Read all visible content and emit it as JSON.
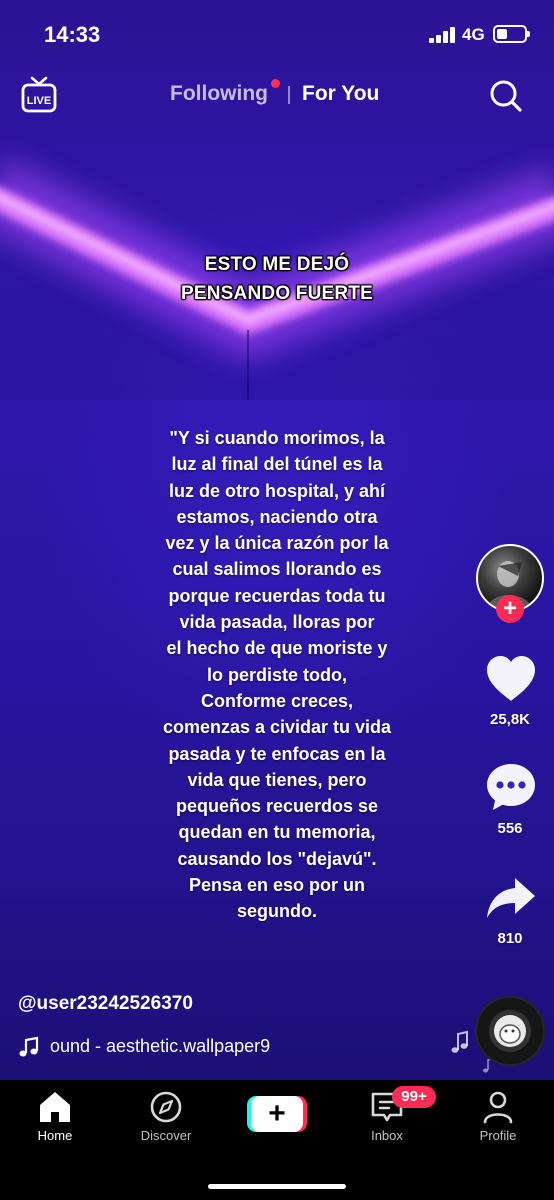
{
  "status_bar": {
    "time": "14:33",
    "network": "4G",
    "battery_level": 0.4
  },
  "top_nav": {
    "live_icon": "live-tv-icon",
    "tabs": [
      {
        "label": "Following",
        "active": false
      },
      {
        "label": "For You",
        "active": true
      }
    ],
    "search_icon": "search-icon"
  },
  "video": {
    "headline": [
      "ESTO ME DEJÓ",
      "PENSANDO FUERTE"
    ],
    "quote": "\"Y si cuando morimos, la\nluz al final del túnel es la\nluz de otro hospital, y ahí\nestamos, naciendo otra\nvez y la única razón por la\ncual salimos llorando es\nporque recuerdas toda tu\nvida pasada, lloras por\nel hecho de que moriste y\nlo perdiste todo,\nConforme creces,\ncomenzas a cividar tu vida\npasada y te enfocas en la\nvida que tienes, pero\npequeños recuerdos se\nquedan en tu memoria,\ncausando los \"dejavú\".\nPensa en eso por un\nsegundo."
  },
  "rail": {
    "follow_plus": "+",
    "likes": "25,8K",
    "comments": "556",
    "shares": "810"
  },
  "info": {
    "username": "@user23242526370",
    "sound": "ound - aesthetic.wallpaper9"
  },
  "tabbar": {
    "items": [
      {
        "label": "Home",
        "icon": "home-icon"
      },
      {
        "label": "Discover",
        "icon": "compass-icon"
      },
      {
        "label": "Inbox",
        "icon": "inbox-icon"
      },
      {
        "label": "Profile",
        "icon": "profile-icon"
      }
    ],
    "create_symbol": "+",
    "inbox_badge": "99+"
  },
  "colors": {
    "accent": "#fe2c55",
    "cyan": "#25f4ee",
    "video_bg": "#2a15a6",
    "led_glow": "#e47cff"
  }
}
